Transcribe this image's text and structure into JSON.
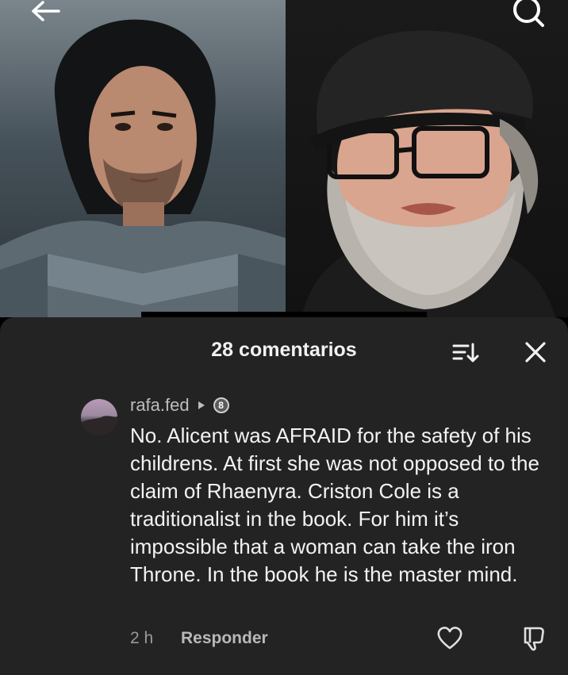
{
  "media": {
    "left_photo": "armored-knight-photo",
    "right_photo": "bearded-man-in-cap-photo"
  },
  "top_bar": {
    "back_icon": "arrow-left-icon",
    "search_icon": "search-icon"
  },
  "comments_panel": {
    "title": "28 comentarios",
    "sort_icon": "sort-icon",
    "close_icon": "close-icon",
    "comment": {
      "username": "rafa.fed",
      "badge": "8",
      "text": "No. Alicent was AFRAID for the safety of his childrens. At first she was not opposed to the claim of Rhaenyra. Criston Cole is a traditionalist in the book. For him it’s impossible that a woman can take the iron Throne. In the book he is the master mind.",
      "time": "2 h",
      "reply_label": "Responder",
      "like_icon": "heart-outline-icon",
      "dislike_icon": "thumbs-down-icon"
    }
  },
  "colors": {
    "panel_bg": "#232323",
    "primary_text": "#f3f3f3",
    "secondary_text": "#9a9a9a"
  }
}
